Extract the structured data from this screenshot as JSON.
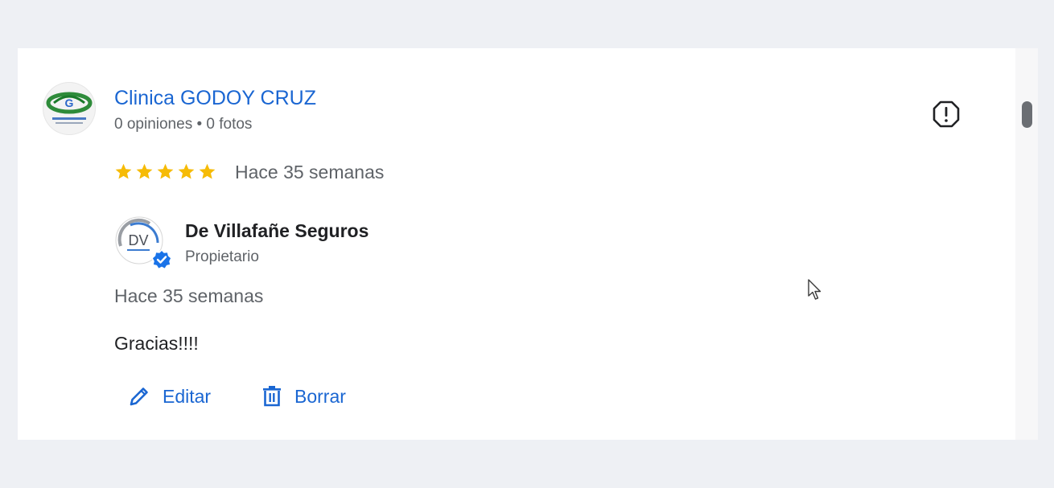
{
  "business": {
    "name": "Clinica GODOY CRUZ",
    "meta": "0 opiniones • 0 fotos",
    "logo_icon": "clinic-logo"
  },
  "review": {
    "rating": 5,
    "rating_max": 5,
    "time": "Hace 35 semanas",
    "star_color": "#f6bb06"
  },
  "reply": {
    "owner_name": "De Villafañe Seguros",
    "owner_role": "Propietario",
    "avatar_text": "DV",
    "time": "Hace 35 semanas",
    "text": "Gracias!!!!"
  },
  "actions": {
    "edit_label": "Editar",
    "delete_label": "Borrar"
  },
  "icons": {
    "report": "report-icon",
    "edit": "pencil-icon",
    "delete": "trash-icon",
    "verified": "verified-badge-icon"
  },
  "colors": {
    "link": "#1a66d2",
    "text_primary": "#202124",
    "text_secondary": "#5f6368",
    "background": "#eef0f4"
  }
}
